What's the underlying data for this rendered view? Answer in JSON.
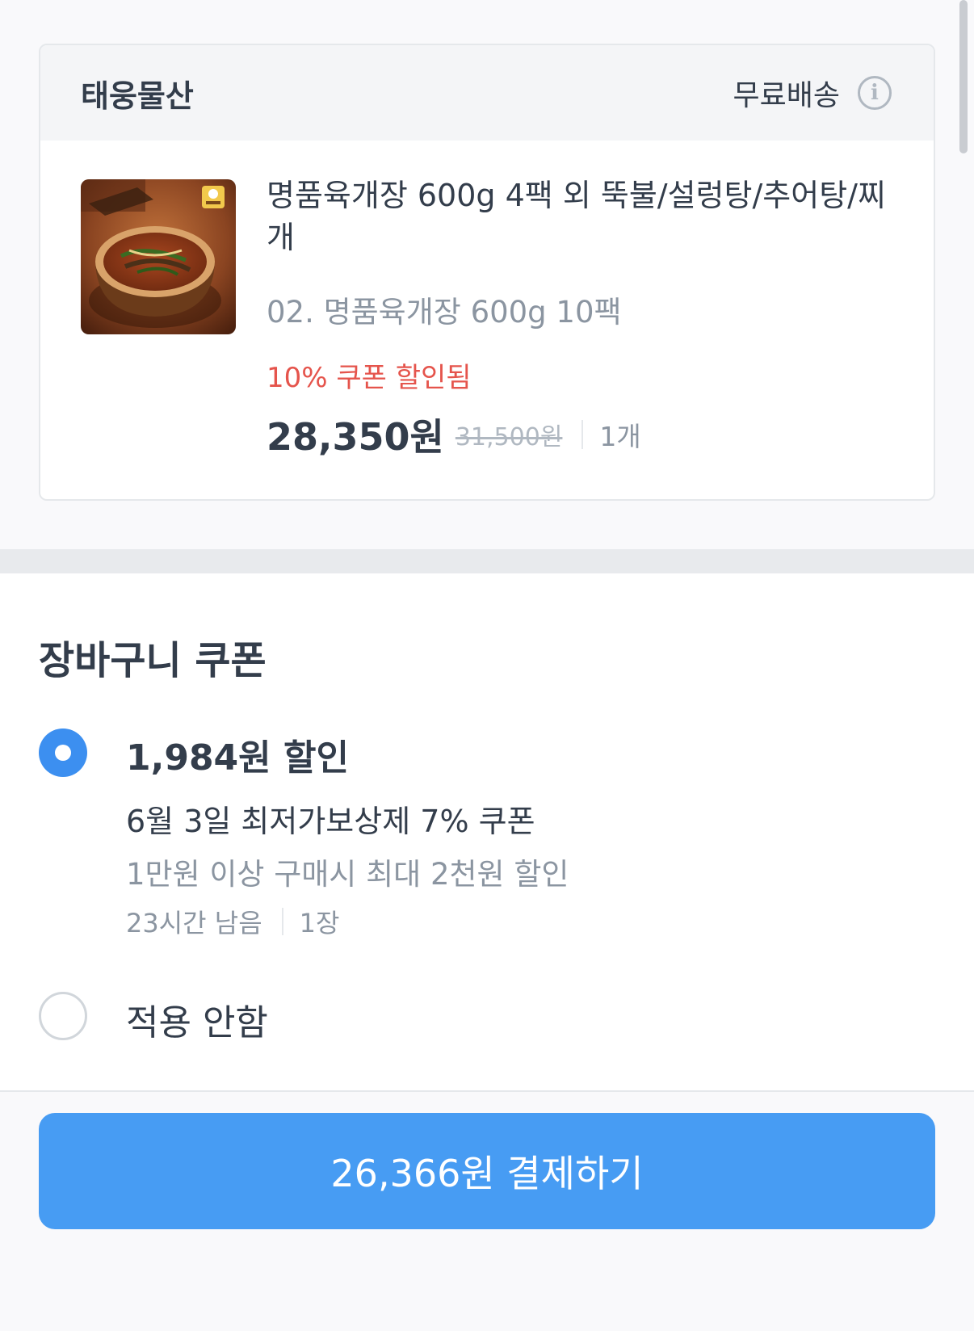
{
  "store": {
    "name": "태웅물산",
    "shipping_label": "무료배송",
    "info_icon": "info-icon"
  },
  "product": {
    "name": "명품육개장 600g 4팩 외 뚝불/설렁탕/추어탕/찌개",
    "option": "02. 명품육개장 600g 10팩",
    "coupon_applied": "10% 쿠폰 할인됨",
    "price_final": "28,350원",
    "price_original": "31,500원",
    "quantity": "1개",
    "thumbnail": "yukgaejang-bowl-image"
  },
  "coupon_section": {
    "title": "장바구니 쿠폰",
    "options": [
      {
        "selected": true,
        "title": "1,984원 할인",
        "name": "6월 3일 최저가보상제 7% 쿠폰",
        "condition": "1만원 이상 구매시 최대 2천원 할인",
        "time_left": "23시간 남음",
        "count": "1장"
      },
      {
        "selected": false,
        "title": "적용 안함"
      }
    ]
  },
  "pay_button": {
    "label": "26,366원 결제하기"
  },
  "colors": {
    "accent": "#479cf3",
    "discount_red": "#e5544c",
    "text_primary": "#333d4b",
    "text_secondary": "#8b95a1"
  }
}
